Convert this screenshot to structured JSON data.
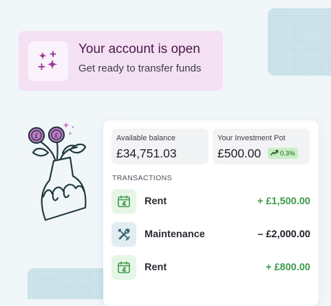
{
  "banner": {
    "title": "Your account is open",
    "subtitle": "Get ready to transfer funds",
    "icon": "sparkles-icon"
  },
  "illustration": {
    "icon": "money-plant-vase-icon",
    "coin_symbol": "£"
  },
  "card": {
    "balance": {
      "label": "Available balance",
      "value": "£34,751.03"
    },
    "pot": {
      "label": "Your Investment Pot",
      "value": "£500.00",
      "change": "0.3%"
    },
    "transactions_heading": "TRANSACTIONS",
    "transactions": [
      {
        "name": "Rent",
        "amount": "+ £1,500.00",
        "icon": "calendar-pound-icon",
        "color": "#3e9a4d"
      },
      {
        "name": "Maintenance",
        "amount": "– £2,000.00",
        "icon": "tools-icon",
        "color": "#22232b"
      },
      {
        "name": "Rent",
        "amount": "+ £800.00",
        "icon": "calendar-pound-icon",
        "color": "#3e9a4d"
      }
    ]
  },
  "colors": {
    "accent_purple": "#9b3c9a",
    "positive_green": "#3e9a4d",
    "icon_teal": "#2e6272",
    "banner_bg": "#f4e1f4"
  }
}
